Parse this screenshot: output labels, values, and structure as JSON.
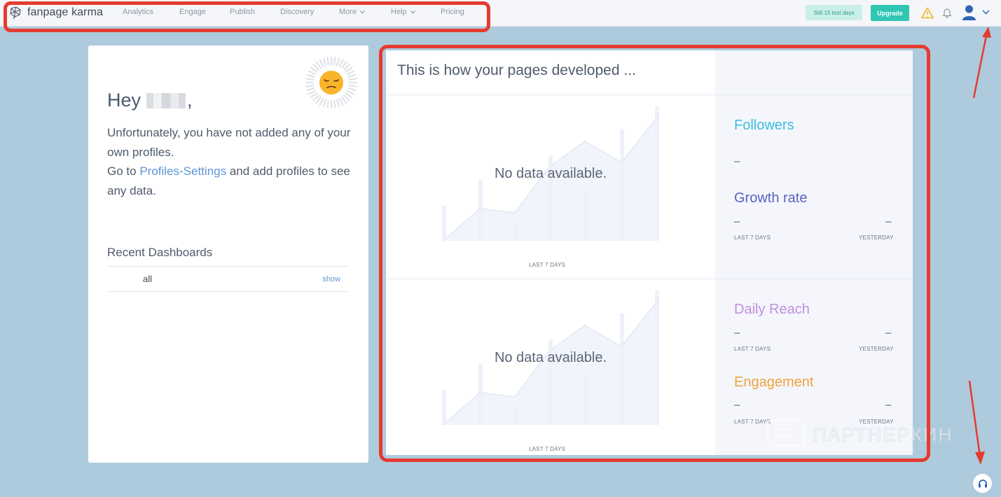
{
  "app": {
    "brand_name": "fanpage karma",
    "brand_icon": "brain-network-icon"
  },
  "nav": {
    "items": [
      {
        "label": "Analytics",
        "has_dropdown": false
      },
      {
        "label": "Engage",
        "has_dropdown": false
      },
      {
        "label": "Publish",
        "has_dropdown": false
      },
      {
        "label": "Discovery",
        "has_dropdown": false
      },
      {
        "label": "More",
        "has_dropdown": true
      },
      {
        "label": "Help",
        "has_dropdown": true
      },
      {
        "label": "Pricing",
        "has_dropdown": false
      }
    ],
    "trial_badge": "Still 15 test days",
    "upgrade_label": "Upgrade",
    "icons": [
      "warning-icon",
      "bell-icon",
      "user-avatar-icon",
      "chevron-down-icon"
    ]
  },
  "welcome": {
    "greeting_prefix": "Hey",
    "greeting_suffix": ",",
    "message_line1": "Unfortunately, you have not added any of your own profiles.",
    "message_go_to": "Go to",
    "message_link": "Profiles-Settings",
    "message_end": "and add profiles to see any data.",
    "emoji": "😔",
    "recent_title": "Recent Dashboards",
    "recent_items": [
      {
        "name": "all",
        "action": "show"
      }
    ]
  },
  "development": {
    "title": "This is how your pages developed ...",
    "sections": [
      {
        "no_data": "No data available.",
        "chart_caption": "LAST 7 DAYS",
        "metrics": [
          {
            "title": "Followers",
            "color": "#3dbde0",
            "value": "–"
          },
          {
            "title": "Growth rate",
            "color": "#5b62c0",
            "left_value": "–",
            "left_caption": "LAST 7 DAYS",
            "right_value": "–",
            "right_caption": "YESTERDAY"
          }
        ]
      },
      {
        "no_data": "No data available.",
        "chart_caption": "LAST 7 DAYS",
        "metrics": [
          {
            "title": "Daily Reach",
            "color": "#c18de0",
            "left_value": "–",
            "left_caption": "LAST 7 DAYS",
            "right_value": "–",
            "right_caption": "YESTERDAY"
          },
          {
            "title": "Engagement",
            "color": "#f0a33c",
            "left_value": "–",
            "left_caption": "LAST 7 DAYS",
            "right_value": "–",
            "right_caption": "YESTERDAY"
          }
        ]
      }
    ]
  },
  "watermark": {
    "text": "ПАРТНЕРКИН",
    "icon": "partnerkin-logo-icon"
  },
  "help": {
    "icon": "headset-icon"
  },
  "colors": {
    "background": "#aecbdd",
    "annotation": "#e53b30",
    "accent": "#2fc7b3",
    "link": "#5e95d6"
  }
}
